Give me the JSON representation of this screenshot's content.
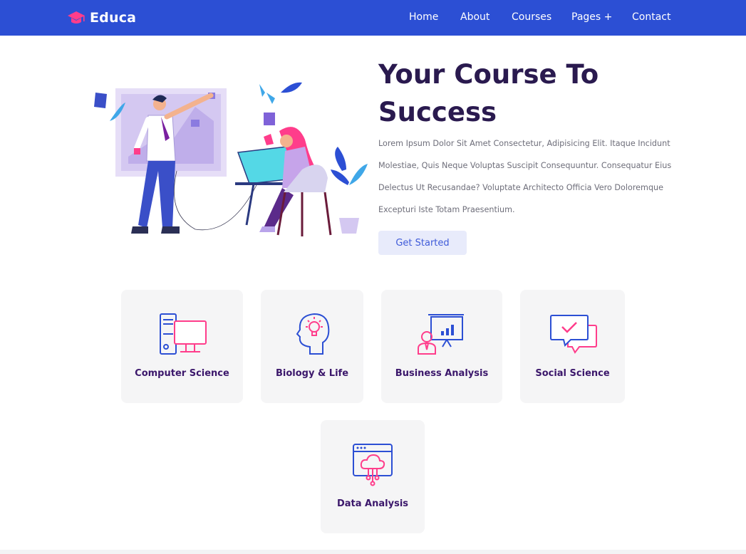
{
  "header": {
    "brand": "Educa",
    "brand_icon": "graduation-cap-icon",
    "nav": [
      "Home",
      "About",
      "Courses",
      "Pages +",
      "Contact"
    ],
    "colors": {
      "bar": "#2c4fd4",
      "brand_icon": "#ff3d8b",
      "text": "#ffffff"
    }
  },
  "hero": {
    "title": "Your Course To Success",
    "description": "Lorem Ipsum Dolor Sit Amet Consectetur, Adipisicing Elit. Itaque Incidunt Molestiae, Quis Neque Voluptas Suscipit Consequuntur. Consequatur Eius Delectus Ut Recusandae? Voluptate Architecto Officia Vero Doloremque Excepturi Iste Totam Praesentium.",
    "cta_label": "Get Started",
    "illustration": "people-at-whiteboard-and-drawing-desk"
  },
  "categories": [
    {
      "label": "Computer Science",
      "icon": "desktop-computer-icon"
    },
    {
      "label": "Biology & Life",
      "icon": "head-with-lightbulb-icon"
    },
    {
      "label": "Business Analysis",
      "icon": "presentation-board-icon"
    },
    {
      "label": "Social Science",
      "icon": "chat-bubbles-icon"
    },
    {
      "label": "Data Analysis",
      "icon": "browser-cloud-icon"
    }
  ],
  "colors": {
    "title": "#2a1a4f",
    "card_label": "#3b176b",
    "icon_blue": "#2c4fd4",
    "icon_pink": "#ff3d8b",
    "card_bg": "#f5f5f6"
  }
}
